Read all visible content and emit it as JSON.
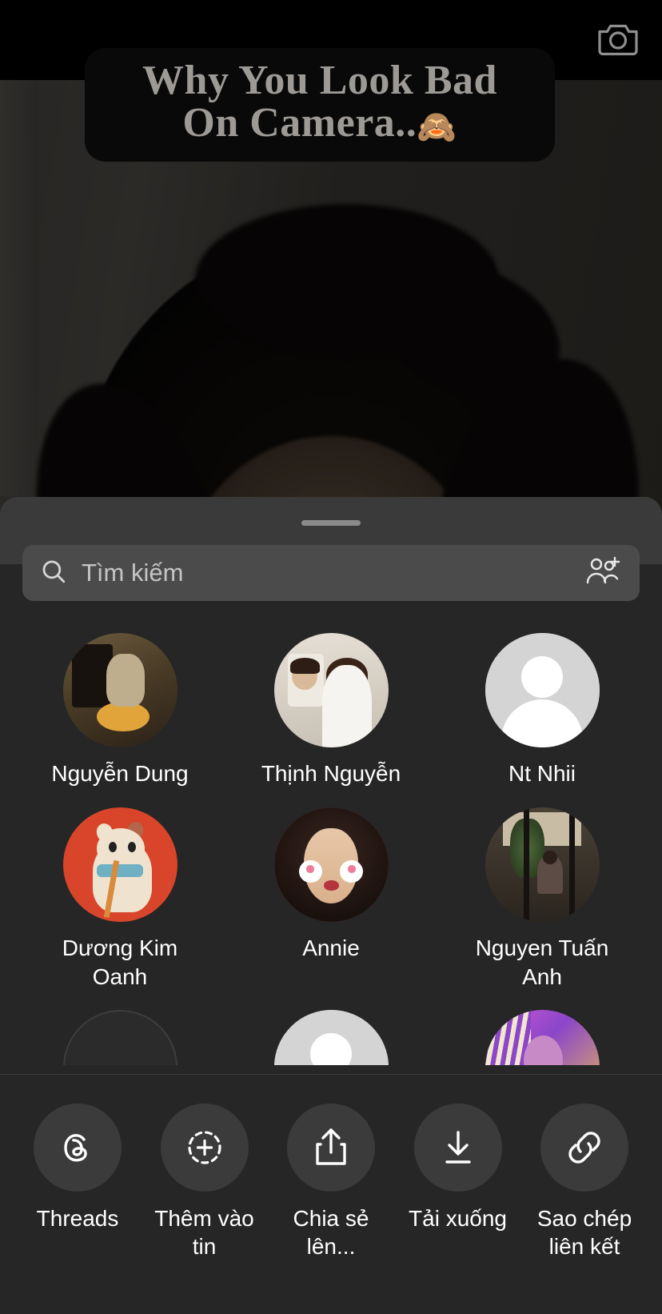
{
  "story": {
    "caption": "Why You Look Bad\nOn Camera..",
    "caption_emoji": "🙈",
    "camera_icon": "camera-icon"
  },
  "share_sheet": {
    "grabber": "drag-handle",
    "search": {
      "placeholder": "Tìm kiếm",
      "value": "",
      "search_icon": "search-icon",
      "add_person_icon": "add-person-icon"
    },
    "contacts": [
      {
        "name": "Nguyễn Dung",
        "avatar": "av-cafe"
      },
      {
        "name": "Thịnh Nguyễn",
        "avatar": "av-mirror"
      },
      {
        "name": "Nt Nhii",
        "avatar": "placeholder"
      },
      {
        "name": "Dương Kim\nOanh",
        "avatar": "av-cat"
      },
      {
        "name": "Annie",
        "avatar": "av-girl"
      },
      {
        "name": "Nguyen Tuấn\nAnh",
        "avatar": "av-window"
      },
      {
        "name": "",
        "avatar": "av-faint"
      },
      {
        "name": "",
        "avatar": "placeholder"
      },
      {
        "name": "",
        "avatar": "av-purple"
      }
    ],
    "actions": [
      {
        "label": "Threads",
        "icon": "threads-icon"
      },
      {
        "label": "Thêm vào tin",
        "icon": "add-to-story-icon"
      },
      {
        "label": "Chia sẻ lên...",
        "icon": "share-icon"
      },
      {
        "label": "Tải xuống",
        "icon": "download-icon"
      },
      {
        "label": "Sao chép\nliên kết",
        "icon": "link-icon"
      }
    ]
  },
  "colors": {
    "sheet_bg": "#262626",
    "sheet_top": "#3a3a3b",
    "search_bg": "#4b4b4c",
    "action_circle": "#3b3b3b",
    "text": "#ffffff",
    "placeholder_text": "#c4c4c4",
    "caption_text": "#9d9a96"
  }
}
